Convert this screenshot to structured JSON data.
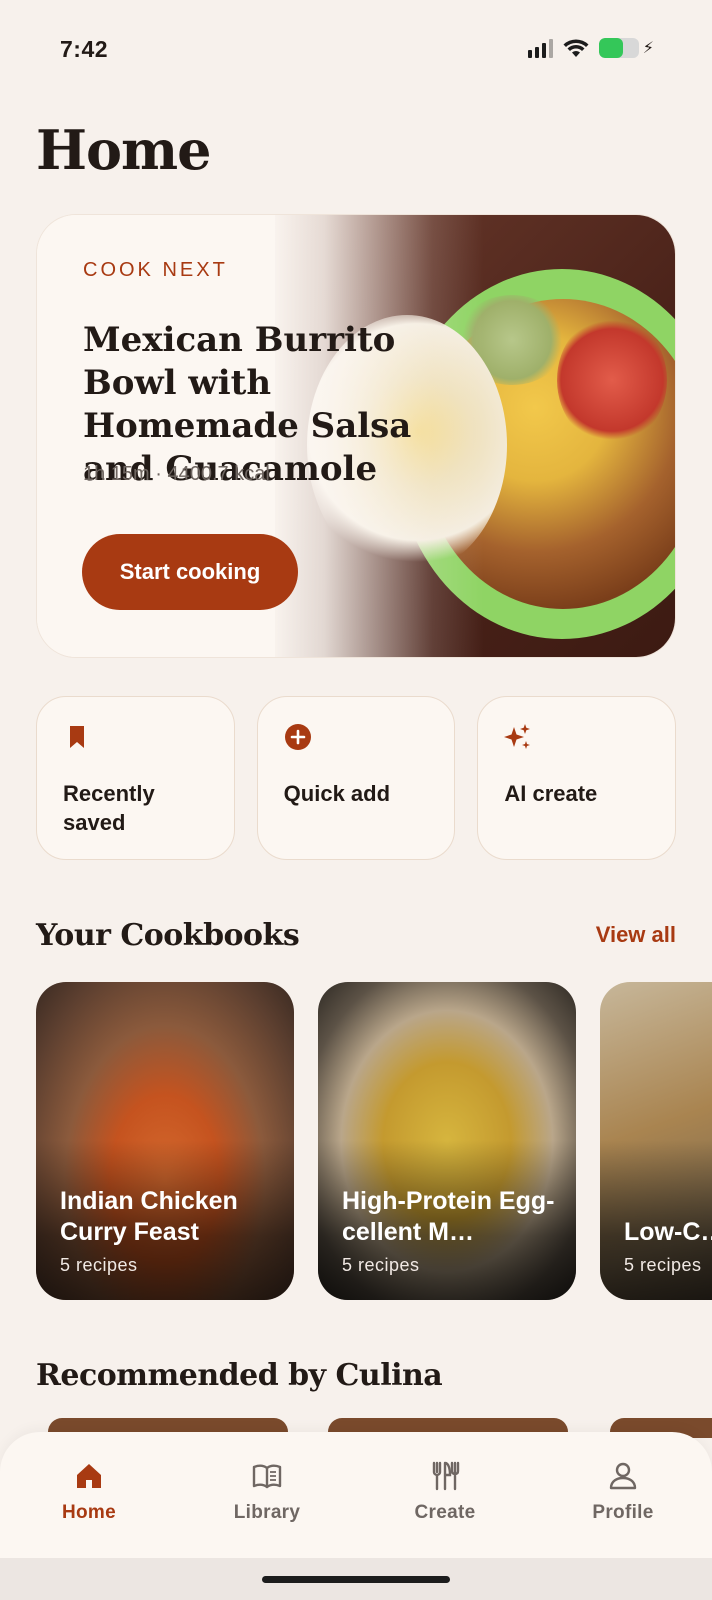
{
  "status_bar": {
    "time": "7:42",
    "battery_level": 0.6
  },
  "page": {
    "title": "Home"
  },
  "hero": {
    "kicker": "COOK NEXT",
    "title": "Mexican Burrito Bowl with Homemade Salsa and Guacamole",
    "meta": "1h 15m · 4400.7 kcal",
    "cta_label": "Start cooking"
  },
  "quick_actions": [
    {
      "label": "Recently saved",
      "icon": "bookmark-icon"
    },
    {
      "label": "Quick add",
      "icon": "plus-circle-icon"
    },
    {
      "label": "AI create",
      "icon": "sparkles-icon"
    }
  ],
  "cookbooks": {
    "title": "Your Cookbooks",
    "view_all_label": "View all",
    "items": [
      {
        "name": "Indian Chicken Curry Feast",
        "count": "5 recipes"
      },
      {
        "name": "High-Protein Egg-cellent M…",
        "count": "5 recipes"
      },
      {
        "name": "Low-C… Indian",
        "count": "5 recipes"
      }
    ]
  },
  "recommended": {
    "title": "Recommended by Culina"
  },
  "nav": {
    "items": [
      {
        "label": "Home",
        "icon": "home-icon",
        "active": true
      },
      {
        "label": "Library",
        "icon": "book-icon",
        "active": false
      },
      {
        "label": "Create",
        "icon": "utensils-icon",
        "active": false
      },
      {
        "label": "Profile",
        "icon": "person-icon",
        "active": false
      }
    ]
  },
  "colors": {
    "accent": "#a83a12",
    "background": "#f7f1ec",
    "card": "#fcf7f2"
  }
}
